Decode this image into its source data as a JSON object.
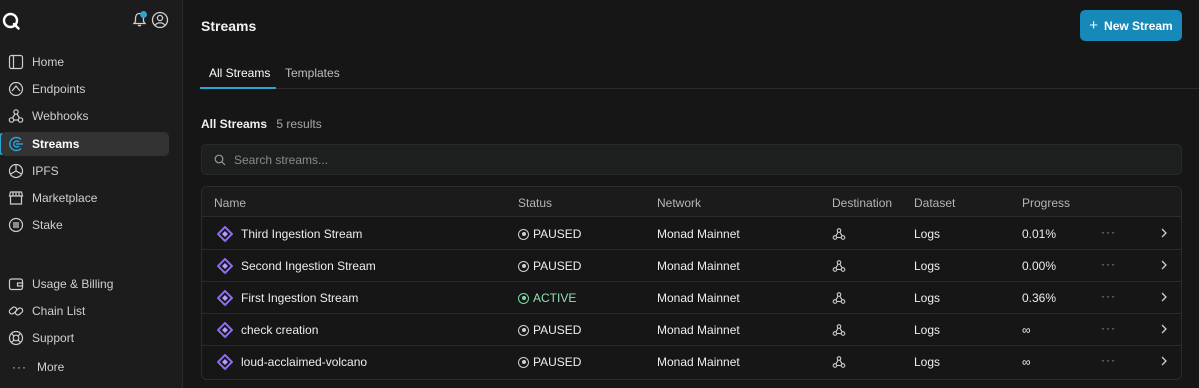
{
  "sidebar": {
    "nav_main": [
      {
        "label": "Home",
        "icon": "home-icon"
      },
      {
        "label": "Endpoints",
        "icon": "endpoints-icon"
      },
      {
        "label": "Webhooks",
        "icon": "webhooks-icon"
      },
      {
        "label": "Streams",
        "icon": "streams-icon",
        "active": true
      },
      {
        "label": "IPFS",
        "icon": "ipfs-icon"
      },
      {
        "label": "Marketplace",
        "icon": "marketplace-icon"
      },
      {
        "label": "Stake",
        "icon": "stake-icon"
      }
    ],
    "nav_bottom": [
      {
        "label": "Usage & Billing",
        "icon": "wallet-icon"
      },
      {
        "label": "Chain List",
        "icon": "link-icon"
      },
      {
        "label": "Support",
        "icon": "lifebuoy-icon"
      }
    ],
    "more_label": "More"
  },
  "header": {
    "title": "Streams",
    "new_button_label": "New Stream"
  },
  "tabs": [
    {
      "label": "All Streams",
      "active": true
    },
    {
      "label": "Templates",
      "active": false
    }
  ],
  "list": {
    "title": "All Streams",
    "count_text": "5 results",
    "search_placeholder": "Search streams...",
    "columns": [
      "Name",
      "Status",
      "Network",
      "Destination",
      "Dataset",
      "Progress"
    ],
    "rows": [
      {
        "name": "Third Ingestion Stream",
        "status": "PAUSED",
        "network": "Monad Mainnet",
        "dataset": "Logs",
        "progress": "0.01%"
      },
      {
        "name": "Second Ingestion Stream",
        "status": "PAUSED",
        "network": "Monad Mainnet",
        "dataset": "Logs",
        "progress": "0.00%"
      },
      {
        "name": "First Ingestion Stream",
        "status": "ACTIVE",
        "network": "Monad Mainnet",
        "dataset": "Logs",
        "progress": "0.36%"
      },
      {
        "name": "check creation",
        "status": "PAUSED",
        "network": "Monad Mainnet",
        "dataset": "Logs",
        "progress": "∞"
      },
      {
        "name": "loud-acclaimed-volcano",
        "status": "PAUSED",
        "network": "Monad Mainnet",
        "dataset": "Logs",
        "progress": "∞"
      }
    ]
  },
  "colors": {
    "accent": "#2ba4d4",
    "button": "#1689b8",
    "active_status": "#8fe0b0",
    "stream_icon": "#8b6cf0"
  }
}
